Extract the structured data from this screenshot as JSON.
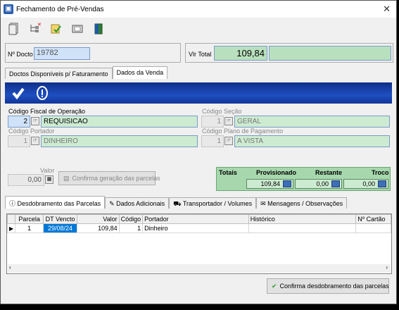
{
  "window": {
    "title": "Fechamento de Pré-Vendas"
  },
  "header": {
    "doc_label": "Nº Docto",
    "doc_value": "19782",
    "total_label": "Vlr Total",
    "total_value": "109,84"
  },
  "main_tabs": [
    "Doctos Disponíveis p/ Faturamento",
    "Dados da Venda"
  ],
  "fields": {
    "fiscal_label": "Código Fiscal de Operação",
    "fiscal_code": "2",
    "fiscal_name": "REQUISICAO",
    "secao_label": "Código Seção",
    "secao_code": "1",
    "secao_name": "GERAL",
    "portador_label": "Código Portador",
    "portador_code": "1",
    "portador_name": "DINHEIRO",
    "plano_label": "Código Plano de Pagamento",
    "plano_code": "1",
    "plano_name": "A VISTA",
    "valor_label": "Valor",
    "valor_value": "0,00",
    "confirm_parcelas": "Confirma geração das parcelas"
  },
  "totals": {
    "totais": "Totais",
    "provisionado": "Provisionado",
    "restante": "Restante",
    "troco": "Troco",
    "prov_value": "109,84",
    "rest_value": "0,00",
    "troco_value": "0,00"
  },
  "sub_tabs": [
    "Desdobramento das Parcelas",
    "Dados Adicionais",
    "Transportador / Volumes",
    "Mensagens / Observações"
  ],
  "grid": {
    "columns": [
      "Parcela",
      "DT Vencto",
      "Valor",
      "Código",
      "Portador",
      "Histórico",
      "Nº Cartão"
    ],
    "rows": [
      {
        "parcela": "1",
        "vencto": "29/08/24",
        "valor": "109,84",
        "codigo": "1",
        "portador": "Dinheiro",
        "historico": "",
        "cartao": ""
      }
    ]
  },
  "confirm_desdobramento": "Confirma desdobramento das parcelas",
  "colors": {
    "accent_blue": "#1e4fc0",
    "green_field": "#cdebd1",
    "total_green": "#a7d7ad"
  }
}
